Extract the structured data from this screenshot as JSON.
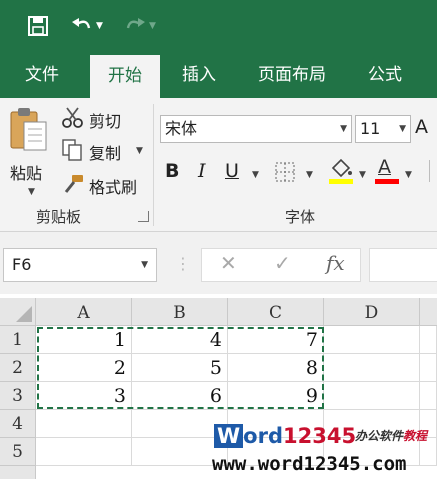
{
  "quick_access": {
    "save": "save-icon",
    "undo": "undo-icon",
    "redo": "redo-icon"
  },
  "tabs": [
    {
      "label": "文件"
    },
    {
      "label": "开始",
      "active": true
    },
    {
      "label": "插入"
    },
    {
      "label": "页面布局"
    },
    {
      "label": "公式"
    }
  ],
  "clipboard": {
    "paste": "粘贴",
    "cut": "剪切",
    "copy": "复制",
    "format_painter": "格式刷",
    "group_label": "剪贴板"
  },
  "font": {
    "name": "宋体",
    "size": "11",
    "grow_glyph": "A",
    "bold": "B",
    "italic": "I",
    "underline": "U",
    "font_color_glyph": "A",
    "group_label": "字体",
    "fill_color": "#ffff00",
    "text_color": "#ff0000"
  },
  "formula_bar": {
    "name_box": "F6",
    "cancel_glyph": "✕",
    "enter_glyph": "✓",
    "fx": "fx",
    "value": ""
  },
  "sheet": {
    "columns": [
      "A",
      "B",
      "C",
      "D"
    ],
    "rows": [
      "1",
      "2",
      "3",
      "4",
      "5"
    ],
    "cells": [
      [
        "1",
        "4",
        "7",
        ""
      ],
      [
        "2",
        "5",
        "8",
        ""
      ],
      [
        "3",
        "6",
        "9",
        ""
      ],
      [
        "",
        "",
        "",
        ""
      ],
      [
        "",
        "",
        "",
        ""
      ]
    ]
  },
  "watermark": {
    "logo_w": "W",
    "logo_ord": "ord",
    "logo_num": "12345",
    "tag_a": "办公软件",
    "tag_b": "教程",
    "url": "www.word12345.com"
  },
  "colors": {
    "accent": "#217346"
  }
}
